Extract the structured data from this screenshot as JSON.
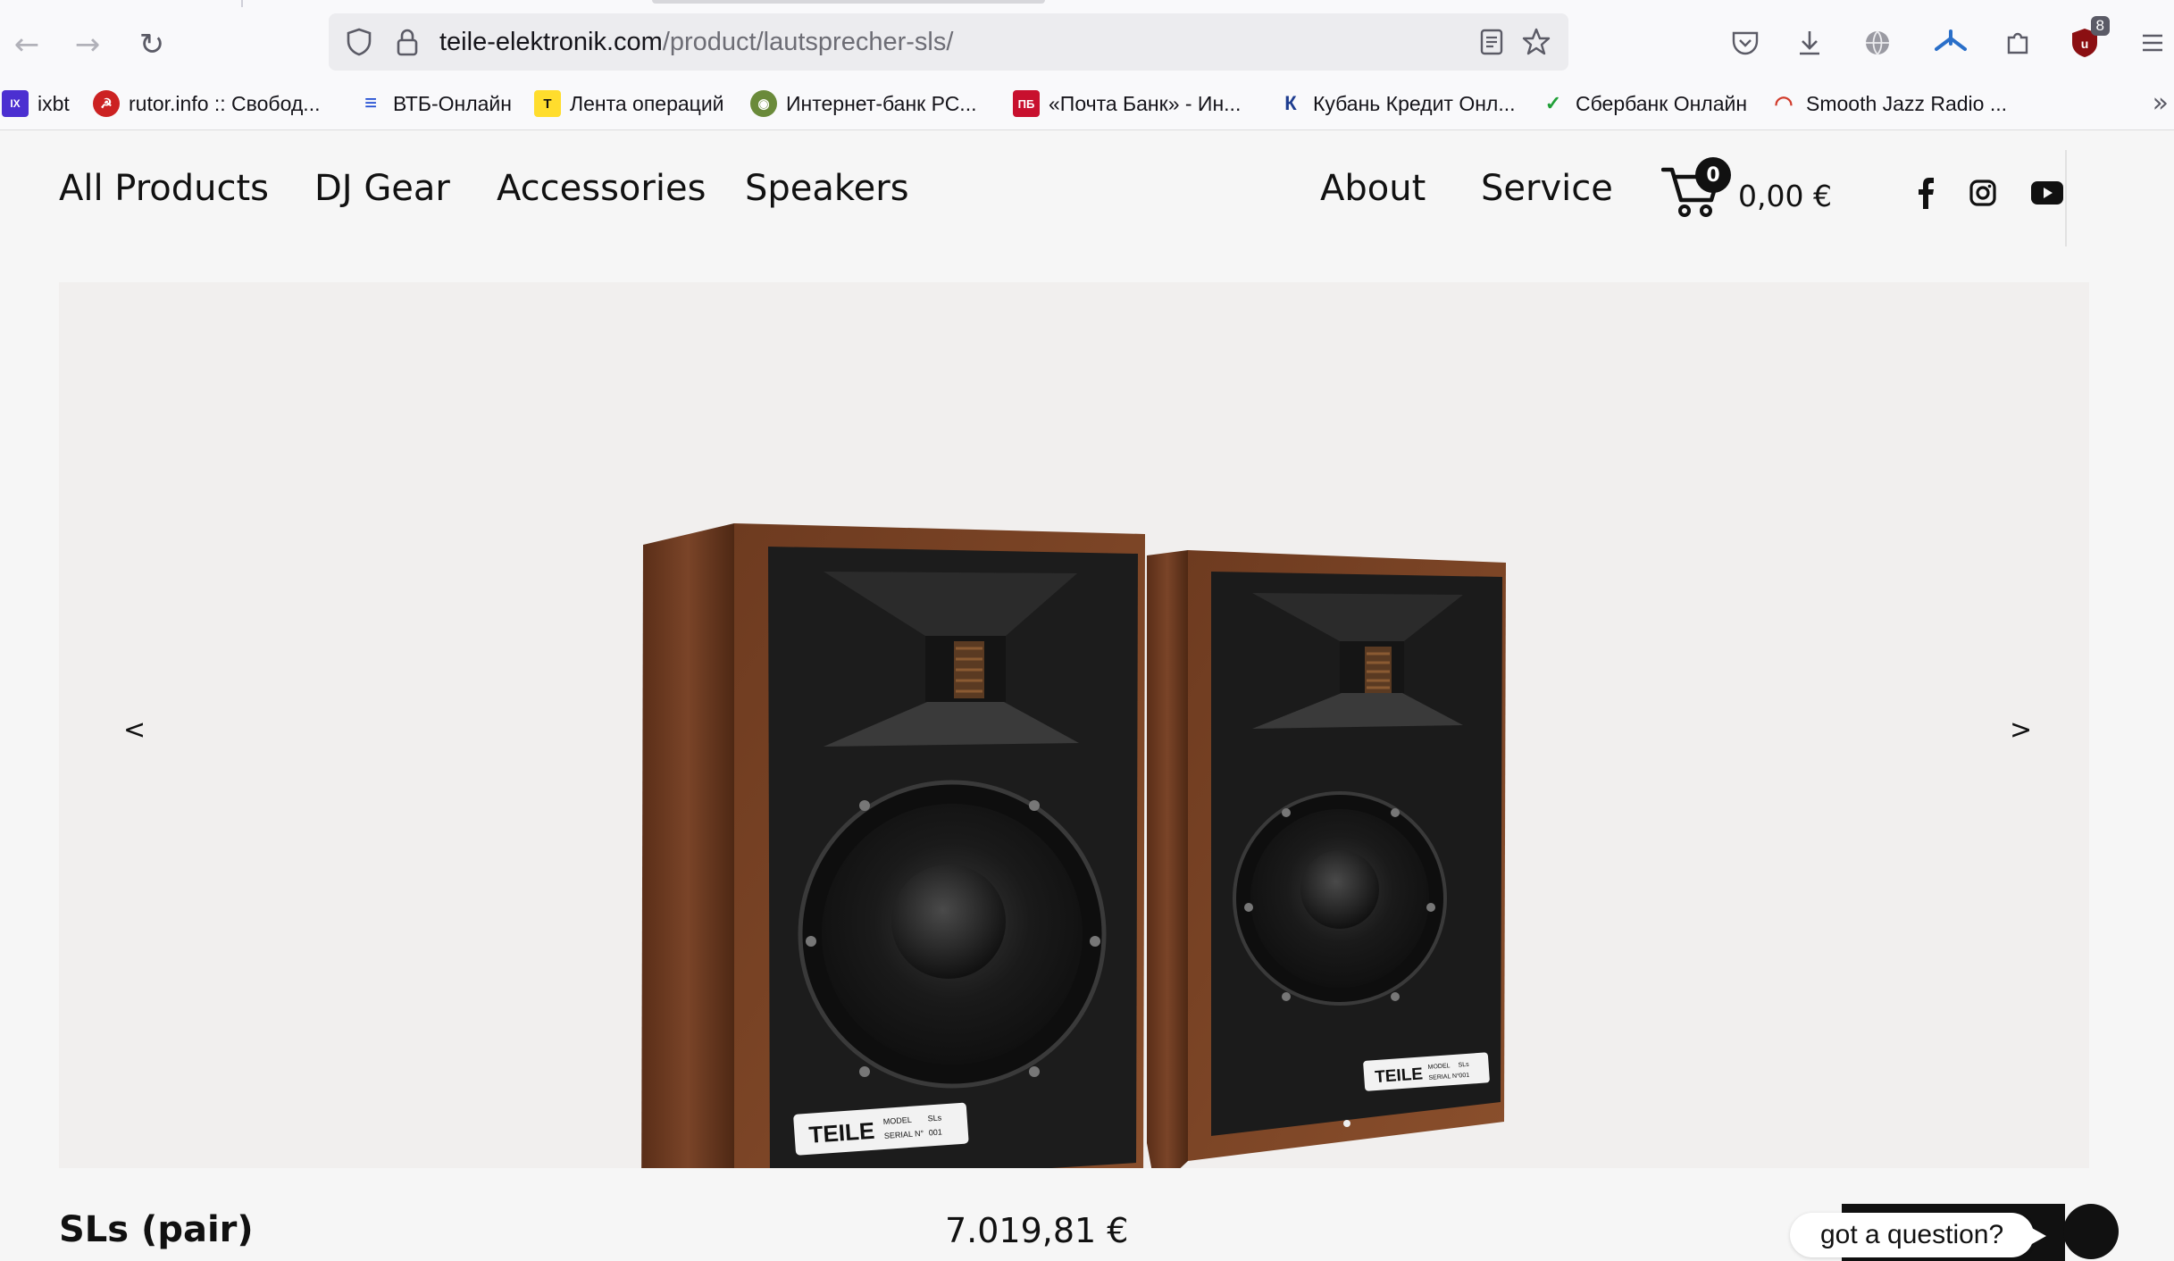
{
  "browser": {
    "url_host": "teile-elektronik.com",
    "url_path": "/product/lautsprecher-sls/",
    "extensions_badge": "8"
  },
  "bookmarks": [
    {
      "label": "ixbt",
      "icon": "ixbt-icon",
      "color": "#4b2fd1",
      "glyph": "IX"
    },
    {
      "label": "rutor.info :: Свобод...",
      "icon": "rutor-icon",
      "color": "#c22",
      "glyph": "☭"
    },
    {
      "label": "ВТБ-Онлайн",
      "icon": "vtb-icon",
      "color": "#1e4bd2",
      "glyph": "≡"
    },
    {
      "label": "Лента операций",
      "icon": "tinkoff-icon",
      "color": "#ffdd2d",
      "glyph": "T"
    },
    {
      "label": "Интернет-банк РС...",
      "icon": "rs-bank-icon",
      "color": "#6a8a3a",
      "glyph": "◉"
    },
    {
      "label": "«Почта Банк» - Ин...",
      "icon": "pochta-bank-icon",
      "color": "#c8102e",
      "glyph": "ПБ"
    },
    {
      "label": "Кубань Кредит Онл...",
      "icon": "kuban-credit-icon",
      "color": "#1d3c8f",
      "glyph": "К"
    },
    {
      "label": "Сбербанк Онлайн",
      "icon": "sberbank-icon",
      "color": "#21a038",
      "glyph": "✓"
    },
    {
      "label": "Smooth Jazz Radio ...",
      "icon": "radio-icon",
      "color": "#d13a2a",
      "glyph": "◠"
    }
  ],
  "nav": {
    "left": [
      "All Products",
      "DJ Gear",
      "Accessories",
      "Speakers"
    ],
    "right": [
      "About",
      "Service"
    ],
    "cart_count": "0",
    "cart_total": "0,00 €"
  },
  "gallery": {
    "prev": "<",
    "next": ">",
    "image": "teile-sls-speaker-pair",
    "plate_brand": "TEILE",
    "plate_model_label": "MODEL",
    "plate_model": "SLs",
    "plate_serial_label": "SERIAL N°",
    "plate_serial": "001"
  },
  "product": {
    "name": "SLs (pair)",
    "price": "7.019,81 €"
  },
  "chat": {
    "prompt": "got a question?"
  },
  "colors": {
    "walnut": "#6b3a22",
    "cabinet_front": "#1c1c1c",
    "accent": "#111111"
  }
}
